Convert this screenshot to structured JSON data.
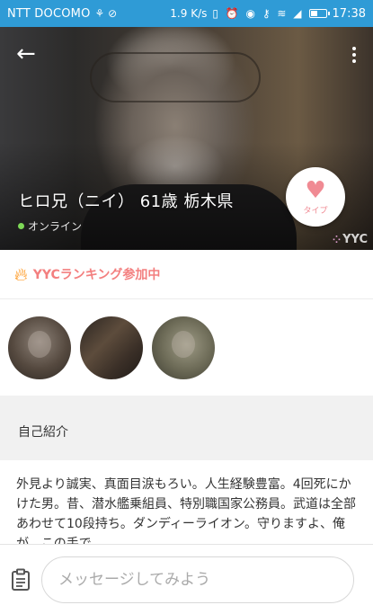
{
  "status_bar": {
    "carrier": "NTT DOCOMO",
    "carrier_icons": "⚘ ⊘",
    "speed": "1.9 K/s",
    "system_icons": "▯ ⏰ ◉ ⚷ ≋ ◢",
    "battery_level": 0.45,
    "time": "17:38",
    "bg_color": "#2f9bd6"
  },
  "profile": {
    "name_line": "ヒロ兄（ニイ） 61歳 栃木県",
    "online_label": "オンライン",
    "online_color": "#7ed957",
    "like_label": "タイプ",
    "like_color": "#f08a93",
    "watermark": "YYC"
  },
  "ranking": {
    "label": "YYCランキング参加中",
    "color": "#f37f7f"
  },
  "intro": {
    "title": "自己紹介",
    "body": "外見より誠実、真面目涙もろい。人生経験豊富。4回死にかけた男。昔、潜水艦乗組員、特別職国家公務員。武道は全部あわせて10段持ち。ダンディーライオン。守りますよ、俺が、この手で。"
  },
  "message": {
    "placeholder": "メッセージしてみよう"
  }
}
